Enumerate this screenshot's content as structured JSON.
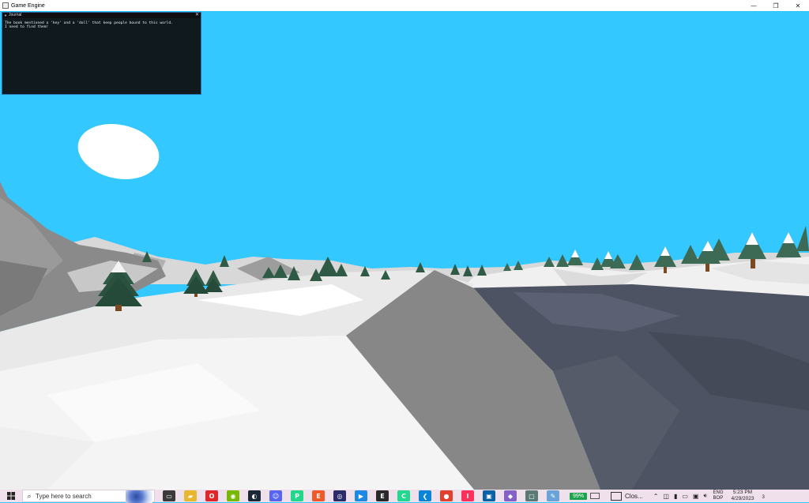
{
  "window": {
    "title": "Game Engine",
    "controls": {
      "minimize": "—",
      "restore": "❐",
      "close": "✕"
    }
  },
  "journal": {
    "title": "Journal",
    "lines": [
      "The book mentioned a 'key' and a 'doll' that keep people bound to this world.",
      "I need to find them!"
    ]
  },
  "scene": {
    "sky_color": "#33c8ff",
    "sun_color": "#ffffff",
    "snow_color": "#f2f2f2",
    "rock_color": "#858585",
    "ice_color": "#4c5160"
  },
  "taskbar": {
    "search_placeholder": "Type here to search",
    "battery_percent": "99%",
    "closed_app_label": "Clos...",
    "language_top": "ENG",
    "language_bottom": "BOP",
    "time": "5:23 PM",
    "date": "4/29/2023",
    "notification_count": "3",
    "apps": [
      {
        "icon": "task-view-icon",
        "glyph": "▭",
        "color": "#3a3a3a"
      },
      {
        "icon": "file-explorer-icon",
        "glyph": "▰",
        "color": "#e8b730"
      },
      {
        "icon": "opera-icon",
        "glyph": "O",
        "color": "#e0252b"
      },
      {
        "icon": "nvidia-icon",
        "glyph": "◉",
        "color": "#76b900"
      },
      {
        "icon": "steam-icon",
        "glyph": "◐",
        "color": "#1b2838"
      },
      {
        "icon": "discord-icon",
        "glyph": "☺",
        "color": "#5865f2"
      },
      {
        "icon": "pycharm-icon",
        "glyph": "P",
        "color": "#21d789"
      },
      {
        "icon": "ea-icon",
        "glyph": "E",
        "color": "#f05a28"
      },
      {
        "icon": "ubisoft-icon",
        "glyph": "◎",
        "color": "#2b2b6b"
      },
      {
        "icon": "media-player-icon",
        "glyph": "▶",
        "color": "#1e88e5"
      },
      {
        "icon": "epic-games-icon",
        "glyph": "E",
        "color": "#2a2a2a"
      },
      {
        "icon": "clion-icon",
        "glyph": "C",
        "color": "#22d88f"
      },
      {
        "icon": "vscode-icon",
        "glyph": "❮",
        "color": "#0a84d8"
      },
      {
        "icon": "chrome-icon",
        "glyph": "●",
        "color": "#e0402e"
      },
      {
        "icon": "intellij-icon",
        "glyph": "I",
        "color": "#fe315d"
      },
      {
        "icon": "window-app-icon",
        "glyph": "▣",
        "color": "#0a62a5"
      },
      {
        "icon": "visual-studio-icon",
        "glyph": "◆",
        "color": "#8561c5"
      },
      {
        "icon": "app-window-icon",
        "glyph": "▢",
        "color": "#5b7a74"
      },
      {
        "icon": "pen-tool-icon",
        "glyph": "✎",
        "color": "#6aa3d8"
      }
    ]
  }
}
